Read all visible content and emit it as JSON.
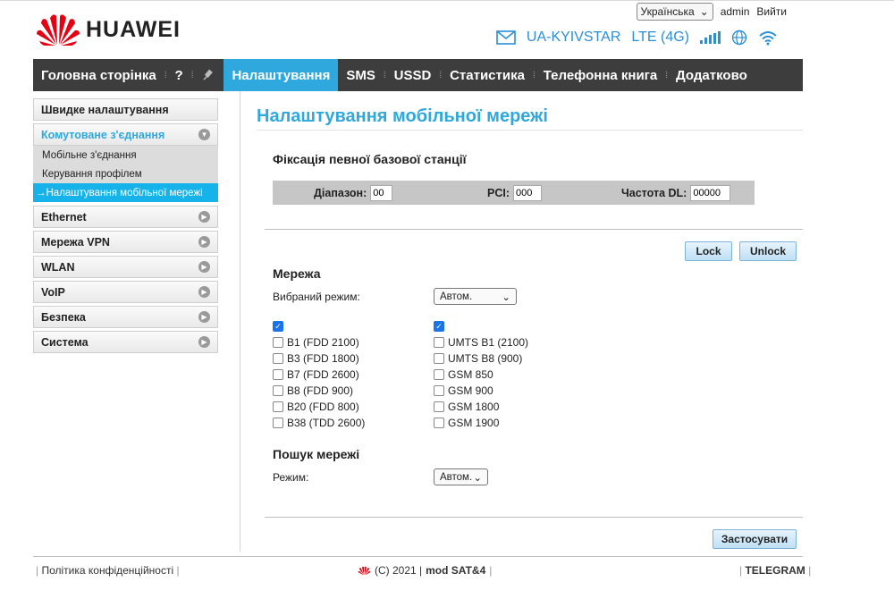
{
  "header": {
    "brand": "HUAWEI",
    "language": "Українська",
    "user": "admin",
    "logout": "Вийти",
    "operator": "UA-KYIVSTAR",
    "network_type": "LTE (4G)"
  },
  "nav": {
    "items": [
      "Головна сторінка",
      "?",
      "Налаштування",
      "SMS",
      "USSD",
      "Статистика",
      "Телефонна книга",
      "Додатково"
    ]
  },
  "sidebar": {
    "quick": "Швидке налаштування",
    "dialup": "Комутоване з'єднання",
    "sub": [
      "Мобільне з'єднання",
      "Керування профілем",
      "Налаштування мобільної мережі"
    ],
    "sections": [
      "Ethernet",
      "Мережа VPN",
      "WLAN",
      "VoIP",
      "Безпека",
      "Система"
    ]
  },
  "main": {
    "title": "Налаштування мобільної мережі",
    "fix_title": "Фіксація певної базової станції",
    "band_label": "Діапазон:",
    "band_value": "00",
    "pci_label": "PCI:",
    "pci_value": "000",
    "freq_label": "Частота DL:",
    "freq_value": "00000",
    "lock": "Lock",
    "unlock": "Unlock",
    "network_title": "Мережа",
    "mode_label": "Вибраний режим:",
    "mode_value": "Автом.",
    "lte_bands": [
      "B1 (FDD 2100)",
      "B3 (FDD 1800)",
      "B7 (FDD 2600)",
      "B8 (FDD 900)",
      "B20 (FDD 800)",
      "B38 (TDD 2600)"
    ],
    "gsm_bands": [
      "UMTS B1 (2100)",
      "UMTS B8 (900)",
      "GSM 850",
      "GSM 900",
      "GSM 1800",
      "GSM 1900"
    ],
    "search_title": "Пошук мережі",
    "search_mode_label": "Режим:",
    "search_mode_value": "Автом.",
    "apply": "Застосувати"
  },
  "footer": {
    "privacy": "Політика конфіденційності",
    "copyright": "(C) 2021 |",
    "mod": "mod SAT&4",
    "telegram": "TELEGRAM"
  },
  "colors": {
    "accent": "#2fa8de",
    "nav_bg": "#3d3d3d",
    "active_sub": "#15b3ea"
  }
}
